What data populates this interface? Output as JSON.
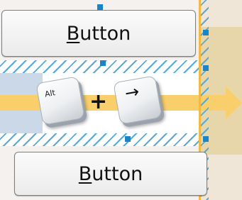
{
  "buttons": {
    "top": {
      "accelerator": "B",
      "rest": "utton"
    },
    "bottom": {
      "accelerator": "B",
      "rest": "utton"
    }
  },
  "shortcut": {
    "key1": "Alt",
    "joiner": "+",
    "key2_glyph": "→",
    "key2_icon": "right-arrow-icon"
  },
  "colors": {
    "guide": "#f3b942",
    "arrow": "#f8cf6a",
    "handle": "#1a84c8",
    "hatch": "#58a9d6"
  }
}
